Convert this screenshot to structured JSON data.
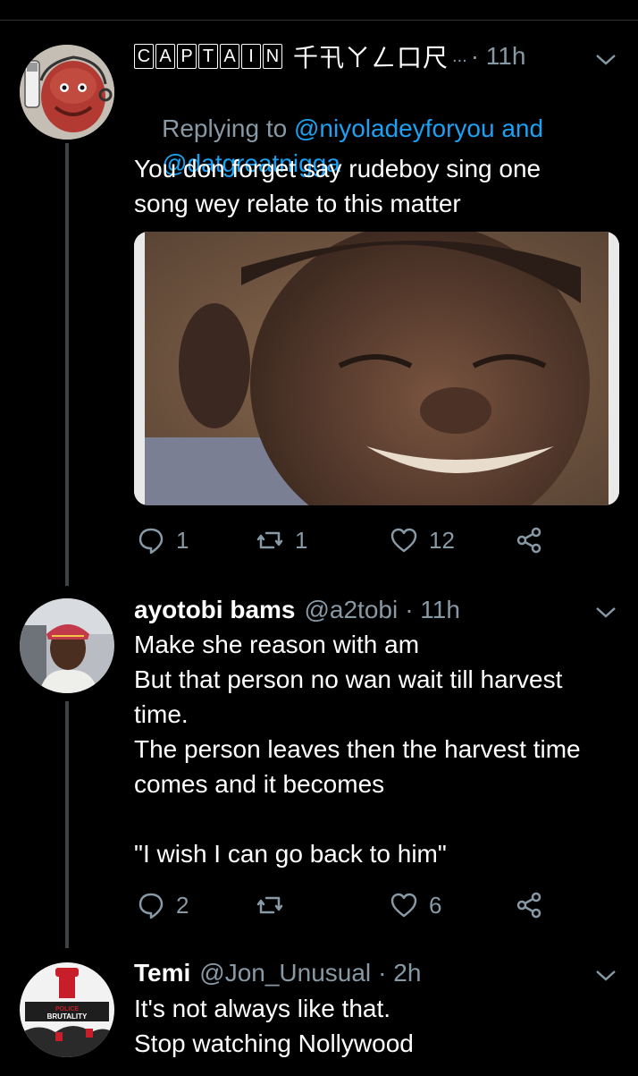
{
  "tweets": [
    {
      "display_name_boxed": [
        "C",
        "A",
        "P",
        "T",
        "A",
        "I",
        "N"
      ],
      "display_name_rest": "千卂ㄚㄥ口尺",
      "ellipsis": "...",
      "time": "· 11h",
      "reply_prefix": "Replying to ",
      "reply_to_1": "@niyoladeyforyou",
      "reply_joiner": " and",
      "reply_to_2": "@datgreatnigga",
      "text": "You don forget say rudeboy sing one\nsong wey relate to this matter",
      "actions": {
        "reply": "1",
        "retweet": "1",
        "like": "12"
      }
    },
    {
      "display_name": "ayotobi bams",
      "handle": "@a2tobi",
      "time": "· 11h",
      "text": "Make she reason with am\nBut that person no wan wait till harvest\ntime.\nThe person leaves then the harvest time\ncomes and it becomes\n\n\"I wish I can go back to him\"",
      "actions": {
        "reply": "2",
        "retweet": "",
        "like": "6"
      }
    },
    {
      "display_name": "Temi",
      "handle": "@Jon_Unusual",
      "time": "· 2h",
      "text": "It's not always like that.\nStop watching Nollywood",
      "avatar_text_1": "POLICE",
      "avatar_text_2": "BRUTALITY"
    }
  ],
  "colors": {
    "background": "#000000",
    "accent": "#1da1f2",
    "muted": "#8899a6"
  },
  "icons": [
    "chevron-down-icon",
    "reply-icon",
    "retweet-icon",
    "like-icon",
    "share-icon"
  ]
}
